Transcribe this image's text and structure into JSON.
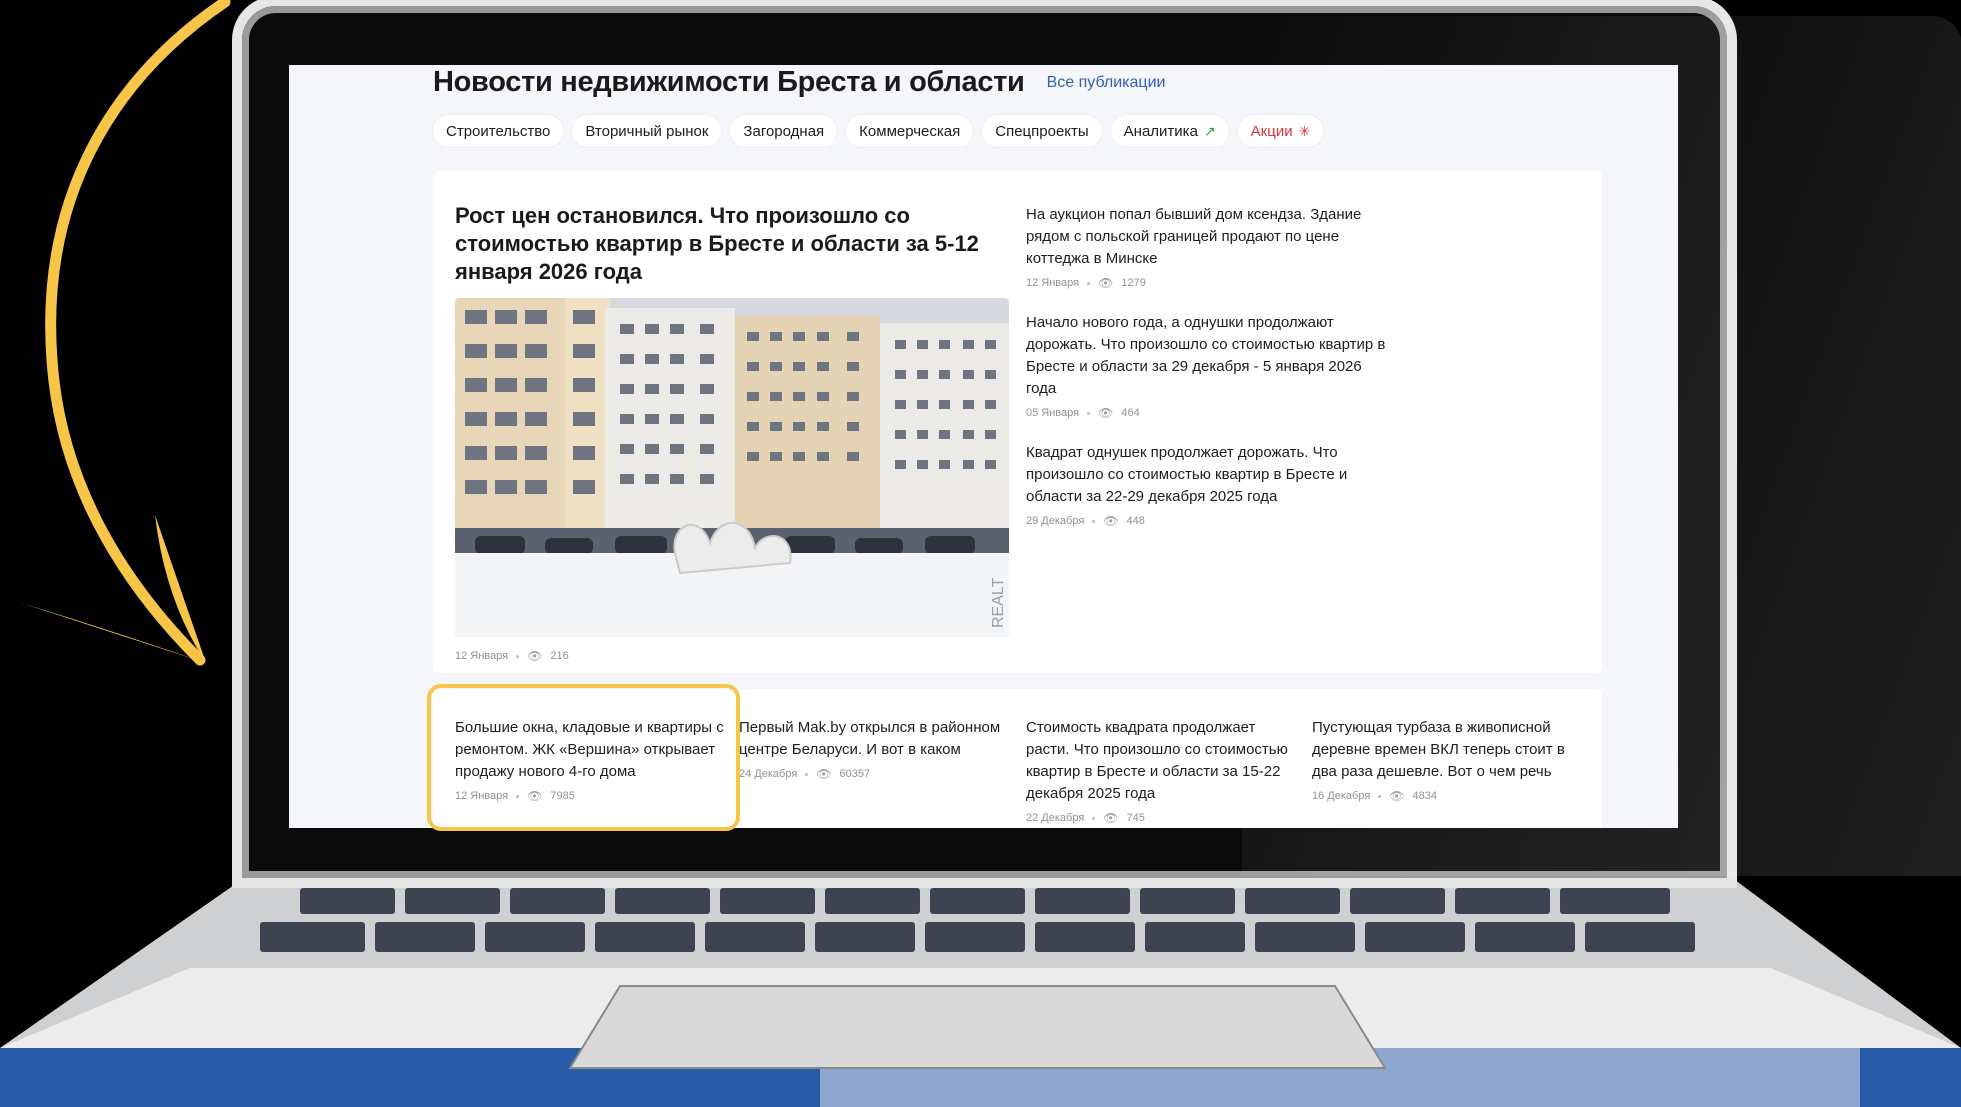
{
  "page": {
    "title": "Новости недвижимости Бреста и области",
    "all_link": "Все публикации"
  },
  "tabs": [
    {
      "label": "Строительство"
    },
    {
      "label": "Вторичный рынок"
    },
    {
      "label": "Загородная"
    },
    {
      "label": "Коммерческая"
    },
    {
      "label": "Спецпроекты"
    },
    {
      "label": "Аналитика",
      "icon": "trend-up-icon",
      "icon_color": "#2aa64a"
    },
    {
      "label": "Акции",
      "icon": "sparkle-icon",
      "icon_color": "#e0323a"
    }
  ],
  "lead": {
    "title": "Рост цен остановился. Что произошло со стоимостью квартир в Бресте и области за 5-12 января 2026 года",
    "date": "12 Января",
    "views": "216",
    "photo_watermark": "REALT"
  },
  "side_news": [
    {
      "title": "На аукцион попал бывший дом ксендза. Здание рядом с польской границей продают по цене коттеджа в Минске",
      "date": "12 Января",
      "views": "1279"
    },
    {
      "title": "Начало нового года, а однушки продолжают дорожать. Что произошло со стоимостью квартир в Бресте и области за 29 декабря - 5 января 2026 года",
      "date": "05 Января",
      "views": "464"
    },
    {
      "title": "Квадрат однушек продолжает дорожать. Что произошло со стоимостью квартир в Бресте и области за 22-29 декабря 2025 года",
      "date": "29 Декабря",
      "views": "448"
    }
  ],
  "bottom_news": [
    {
      "title": "Большие окна, кладовые и квартиры с ремонтом. ЖК «Вершина» открывает продажу нового 4-го дома",
      "date": "12 Января",
      "views": "7985"
    },
    {
      "title": "Первый Mak.by открылся в районном центре Беларуси. И вот в каком",
      "date": "24 Декабря",
      "views": "60357"
    },
    {
      "title": "Стоимость квадрата продолжает расти. Что произошло со стоимостью квартир в Бресте и области за 15-22 декабря 2025 года",
      "date": "22 Декабря",
      "views": "745"
    },
    {
      "title": "Пустующая турбаза в живописной деревне времен ВКЛ теперь стоит в два раза дешевле. Вот о чем речь",
      "date": "16 Декабря",
      "views": "4834"
    }
  ],
  "colors": {
    "accent_highlight": "#f7c548",
    "link": "#2f5fb4",
    "promo": "#e0323a"
  }
}
